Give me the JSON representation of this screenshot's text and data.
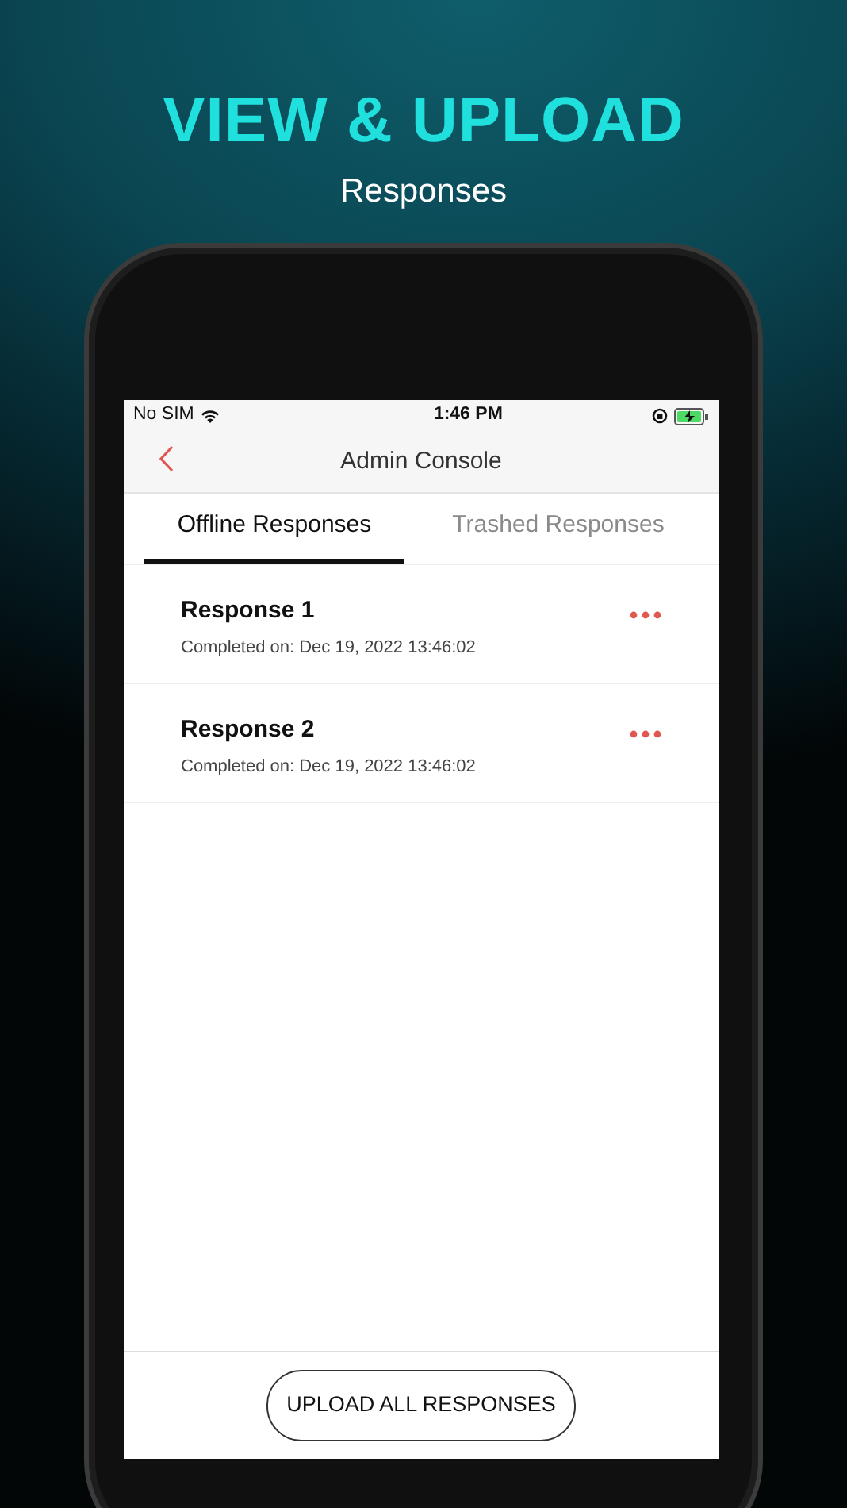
{
  "headline": "VIEW & UPLOAD",
  "subtitle": "Responses",
  "status_bar": {
    "carrier": "No SIM",
    "time": "1:46 PM"
  },
  "nav": {
    "title": "Admin Console"
  },
  "tabs": [
    {
      "label": "Offline Responses",
      "selected": true
    },
    {
      "label": "Trashed Responses",
      "selected": false
    }
  ],
  "responses": [
    {
      "title": "Response 1",
      "completed": "Completed on: Dec 19, 2022 13:46:02"
    },
    {
      "title": "Response 2",
      "completed": "Completed on: Dec 19, 2022 13:46:02"
    }
  ],
  "upload_button": "UPLOAD ALL RESPONSES"
}
